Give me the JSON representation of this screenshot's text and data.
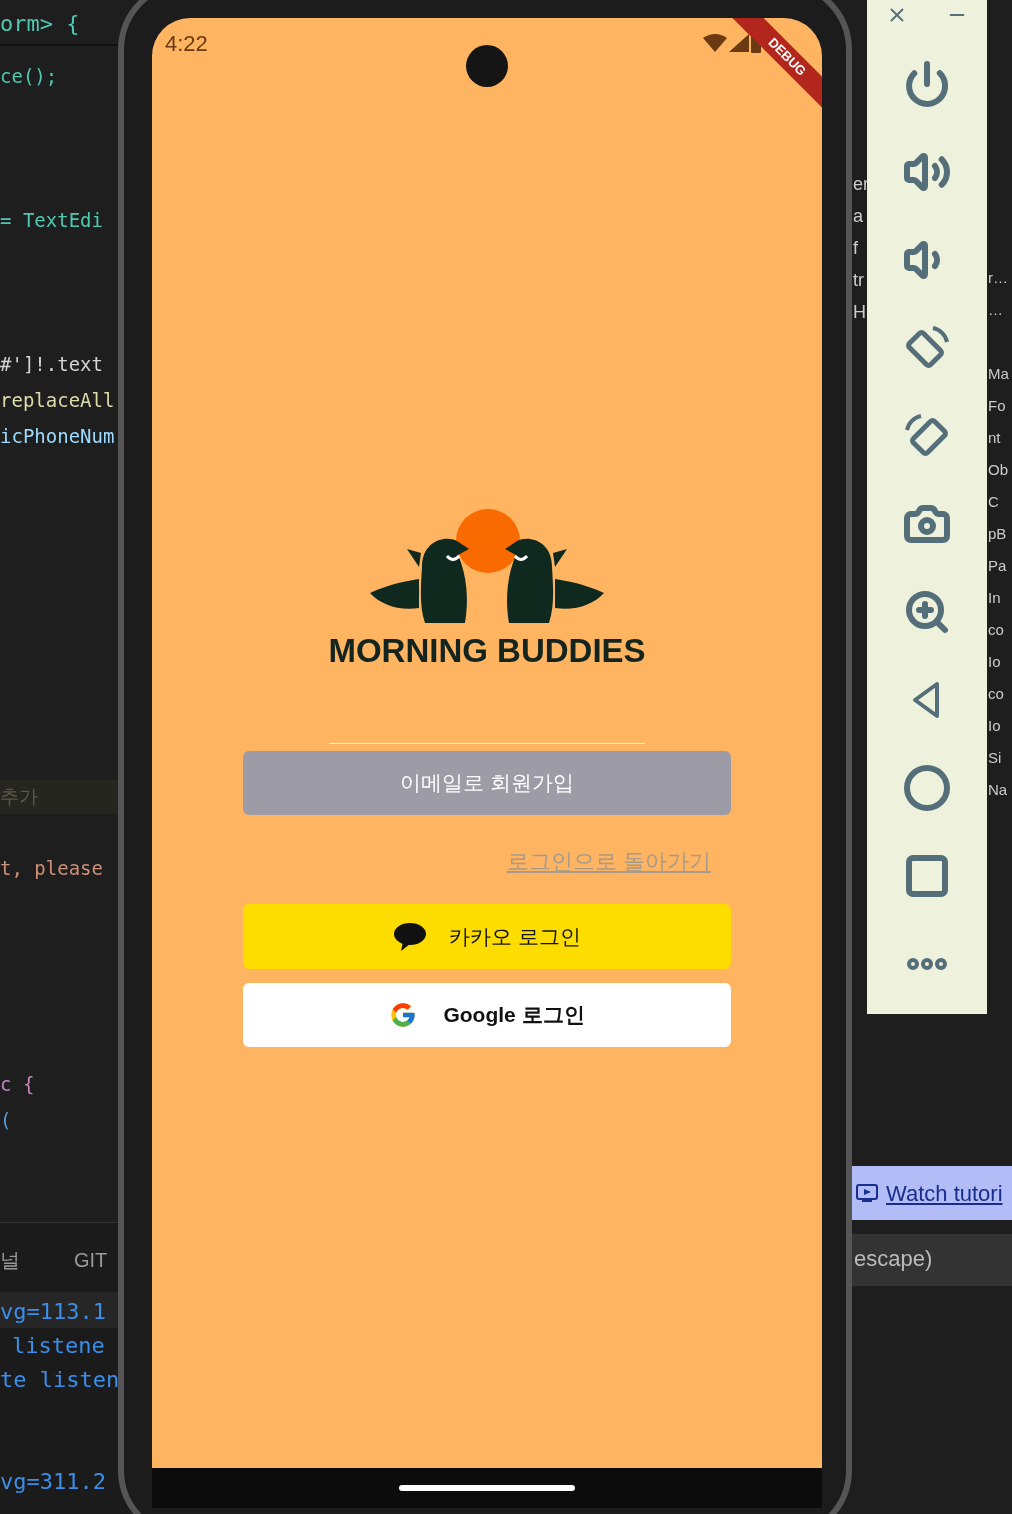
{
  "editor": {
    "header_line": "orm> {",
    "code_lines": [
      {
        "text": "ce();",
        "color": "#4ec9b0"
      },
      {
        "text": "= TextEdi",
        "color": "#4ec9b0"
      },
      {
        "text": "#']!.text",
        "color": "#d4d4d4"
      },
      {
        "text": "replaceAll",
        "color": "#dcdcaa"
      },
      {
        "text": "icPhoneNum",
        "color": "#9cdcfe"
      },
      {
        "text": "추가",
        "color": "#5a5a48"
      },
      {
        "text": "t, please",
        "color": "#ce9178"
      },
      {
        "text": "c {",
        "color": "#c586c0"
      },
      {
        "text": "(",
        "color": "#569cd6"
      }
    ],
    "panel_tabs": [
      "널",
      "GIT"
    ],
    "terminal_lines": [
      "vg=113.1",
      "listene",
      "te listen",
      "vg=311.2"
    ]
  },
  "phone": {
    "status_time": "4:22",
    "debug_banner": "DEBUG",
    "app_name": "MORNING BUDDIES",
    "signup_button": {
      "label": "이메일로 회원가입",
      "disabled": true
    },
    "back_to_login_link": "로그인으로 돌아가기",
    "kakao_button": "카카오 로그인",
    "google_button": "Google 로그인"
  },
  "background_fragments": {
    "middle": [
      "er",
      "a",
      "f",
      "tr",
      "H"
    ],
    "right": [
      "r…",
      "…",
      "Ma",
      "Fo",
      "nt",
      "Ob",
      "C",
      "pB",
      "Pa",
      "In",
      "co",
      "Io",
      "co",
      "Io",
      "Si",
      "Na"
    ]
  },
  "tutorial_link": "Watch tutori",
  "hint_text": "escape)"
}
